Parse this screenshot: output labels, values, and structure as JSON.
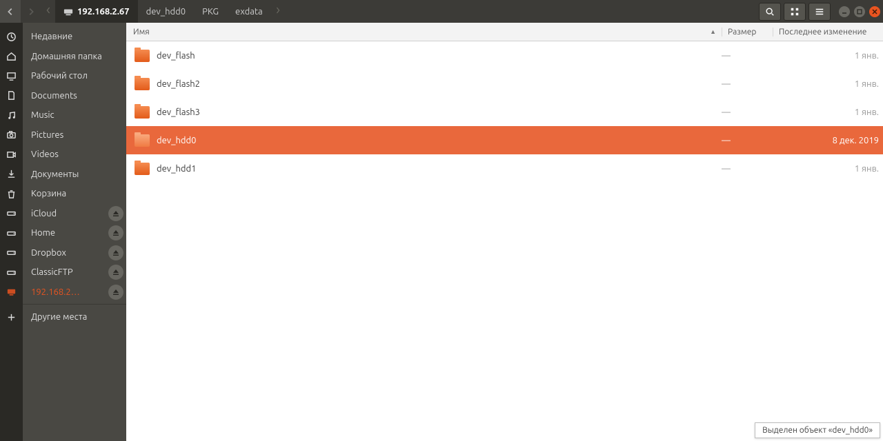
{
  "breadcrumb": {
    "ip": "192.168.2.67",
    "parts": [
      "dev_hdd0",
      "PKG",
      "exdata"
    ]
  },
  "sidebar": {
    "items": [
      {
        "label": "Недавние",
        "icon": "clock"
      },
      {
        "label": "Домашняя папка",
        "icon": "home"
      },
      {
        "label": "Рабочий стол",
        "icon": "desktop"
      },
      {
        "label": "Documents",
        "icon": "document"
      },
      {
        "label": "Music",
        "icon": "music"
      },
      {
        "label": "Pictures",
        "icon": "camera"
      },
      {
        "label": "Videos",
        "icon": "video"
      },
      {
        "label": "Документы",
        "icon": "download"
      },
      {
        "label": "Корзина",
        "icon": "trash"
      },
      {
        "label": "iCloud",
        "icon": "drive",
        "eject": true
      },
      {
        "label": "Home",
        "icon": "drive",
        "eject": true
      },
      {
        "label": "Dropbox",
        "icon": "drive",
        "eject": true
      },
      {
        "label": "ClassicFTP",
        "icon": "drive",
        "eject": true
      },
      {
        "label": "192.168.2…",
        "icon": "network",
        "eject": true,
        "active": true
      },
      {
        "label": "Другие места",
        "icon": "plus",
        "other": true
      }
    ]
  },
  "columns": {
    "name": "Имя",
    "size": "Размер",
    "modified": "Последнее изменение"
  },
  "files": [
    {
      "name": "dev_flash",
      "size": "—",
      "modified": "1 янв."
    },
    {
      "name": "dev_flash2",
      "size": "—",
      "modified": "1 янв."
    },
    {
      "name": "dev_flash3",
      "size": "—",
      "modified": "1 янв."
    },
    {
      "name": "dev_hdd0",
      "size": "—",
      "modified": "8 дек. 2019",
      "selected": true
    },
    {
      "name": "dev_hdd1",
      "size": "—",
      "modified": "1 янв."
    }
  ],
  "status": "Выделен объект «dev_hdd0»"
}
